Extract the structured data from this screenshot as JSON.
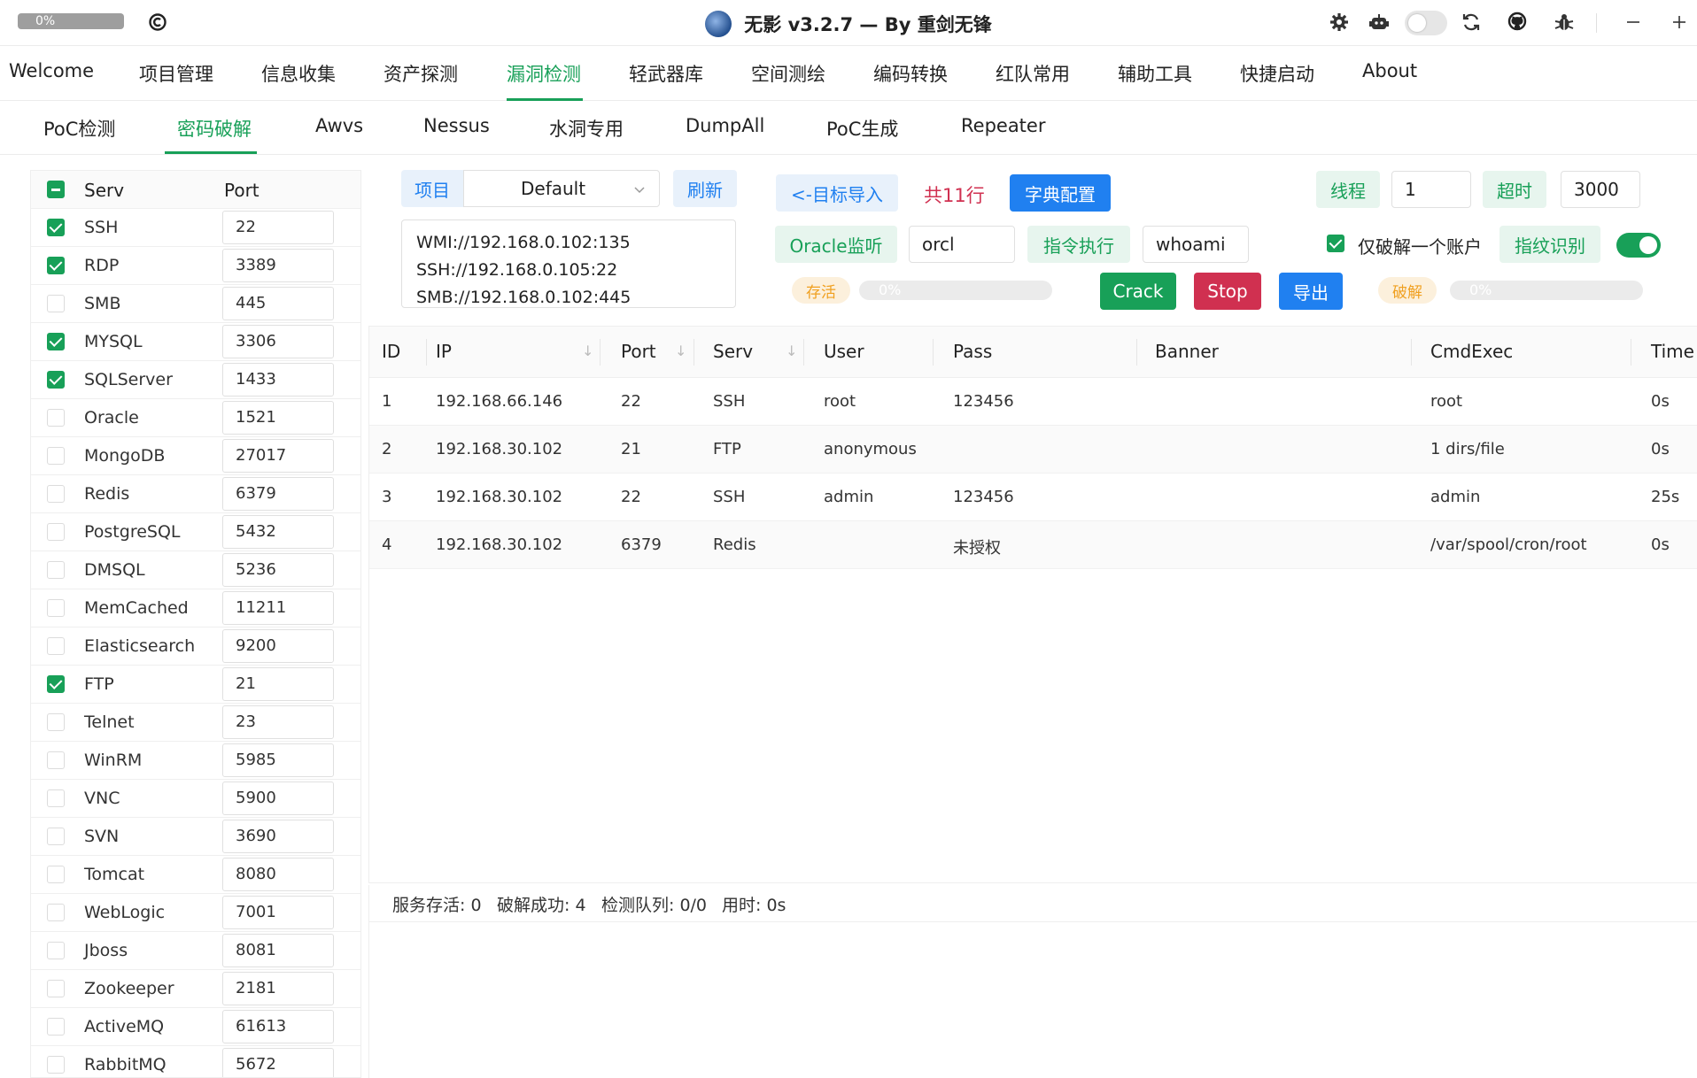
{
  "titlebar": {
    "progress": "0%",
    "title": "无影 v3.2.7 — By 重剑无锋",
    "icons": [
      "copyright-icon",
      "gear-icon",
      "robot-icon",
      "theme-toggle",
      "refresh-icon",
      "github-icon",
      "bug-icon",
      "minimize-icon",
      "maximize-icon"
    ]
  },
  "main_menu": {
    "items": [
      "Welcome",
      "项目管理",
      "信息收集",
      "资产探测",
      "漏洞检测",
      "轻武器库",
      "空间测绘",
      "编码转换",
      "红队常用",
      "辅助工具",
      "快捷启动",
      "About"
    ],
    "active": "漏洞检测"
  },
  "sub_tabs": {
    "items": [
      "PoC检测",
      "密码破解",
      "Awvs",
      "Nessus",
      "水洞专用",
      "DumpAll",
      "PoC生成",
      "Repeater"
    ],
    "active": "密码破解"
  },
  "services": {
    "header": {
      "serv": "Serv",
      "port": "Port"
    },
    "rows": [
      {
        "name": "SSH",
        "port": "22",
        "checked": true
      },
      {
        "name": "RDP",
        "port": "3389",
        "checked": true
      },
      {
        "name": "SMB",
        "port": "445",
        "checked": false
      },
      {
        "name": "MYSQL",
        "port": "3306",
        "checked": true
      },
      {
        "name": "SQLServer",
        "port": "1433",
        "checked": true
      },
      {
        "name": "Oracle",
        "port": "1521",
        "checked": false
      },
      {
        "name": "MongoDB",
        "port": "27017",
        "checked": false
      },
      {
        "name": "Redis",
        "port": "6379",
        "checked": false
      },
      {
        "name": "PostgreSQL",
        "port": "5432",
        "checked": false
      },
      {
        "name": "DMSQL",
        "port": "5236",
        "checked": false
      },
      {
        "name": "MemCached",
        "port": "11211",
        "checked": false
      },
      {
        "name": "Elasticsearch",
        "port": "9200",
        "checked": false
      },
      {
        "name": "FTP",
        "port": "21",
        "checked": true
      },
      {
        "name": "Telnet",
        "port": "23",
        "checked": false
      },
      {
        "name": "WinRM",
        "port": "5985",
        "checked": false
      },
      {
        "name": "VNC",
        "port": "5900",
        "checked": false
      },
      {
        "name": "SVN",
        "port": "3690",
        "checked": false
      },
      {
        "name": "Tomcat",
        "port": "8080",
        "checked": false
      },
      {
        "name": "WebLogic",
        "port": "7001",
        "checked": false
      },
      {
        "name": "Jboss",
        "port": "8081",
        "checked": false
      },
      {
        "name": "Zookeeper",
        "port": "2181",
        "checked": false
      },
      {
        "name": "ActiveMQ",
        "port": "61613",
        "checked": false
      },
      {
        "name": "RabbitMQ",
        "port": "5672",
        "checked": false
      }
    ]
  },
  "controls": {
    "project_label": "项目",
    "project_value": "Default",
    "refresh_label": "刷新",
    "targets": [
      "WMI://192.168.0.102:135",
      "SSH://192.168.0.105:22",
      "SMB://192.168.0.102:445"
    ],
    "import_label": "<-目标导入",
    "line_count": "共11行",
    "dict_config_label": "字典配置",
    "thread_label": "线程",
    "thread_value": "1",
    "timeout_label": "超时",
    "timeout_value": "3000",
    "oracle_label": "Oracle监听",
    "oracle_value": "orcl",
    "cmd_label": "指令执行",
    "cmd_value": "whoami",
    "only_one_label": "仅破解一个账户",
    "only_one_checked": true,
    "fingerprint_label": "指纹识别",
    "fingerprint_on": true,
    "alive_badge": "存活",
    "alive_progress": "0%",
    "crack_label": "Crack",
    "stop_label": "Stop",
    "export_label": "导出",
    "crack_badge": "破解",
    "crack_progress": "0%"
  },
  "results": {
    "columns": [
      "ID",
      "IP",
      "Port",
      "Serv",
      "User",
      "Pass",
      "Banner",
      "CmdExec",
      "Time"
    ],
    "rows": [
      {
        "id": "1",
        "ip": "192.168.66.146",
        "port": "22",
        "serv": "SSH",
        "user": "root",
        "pass": "123456",
        "banner": "",
        "cmd": "root",
        "time": "0s"
      },
      {
        "id": "2",
        "ip": "192.168.30.102",
        "port": "21",
        "serv": "FTP",
        "user": "anonymous",
        "pass": "",
        "banner": "",
        "cmd": "1 dirs/file",
        "time": "0s"
      },
      {
        "id": "3",
        "ip": "192.168.30.102",
        "port": "22",
        "serv": "SSH",
        "user": "admin",
        "pass": "123456",
        "banner": "",
        "cmd": "admin",
        "time": "25s"
      },
      {
        "id": "4",
        "ip": "192.168.30.102",
        "port": "6379",
        "serv": "Redis",
        "user": "",
        "pass": "未授权",
        "banner": "",
        "cmd": "/var/spool/cron/root",
        "time": "0s"
      }
    ]
  },
  "status": {
    "alive": "服务存活: 0",
    "cracked": "破解成功: 4",
    "queue": "检测队列: 0/0",
    "elapsed": "用时: 0s"
  },
  "colors": {
    "accent": "#18a058",
    "blue": "#2080f0",
    "red": "#d03050",
    "warning": "#f0a020"
  }
}
